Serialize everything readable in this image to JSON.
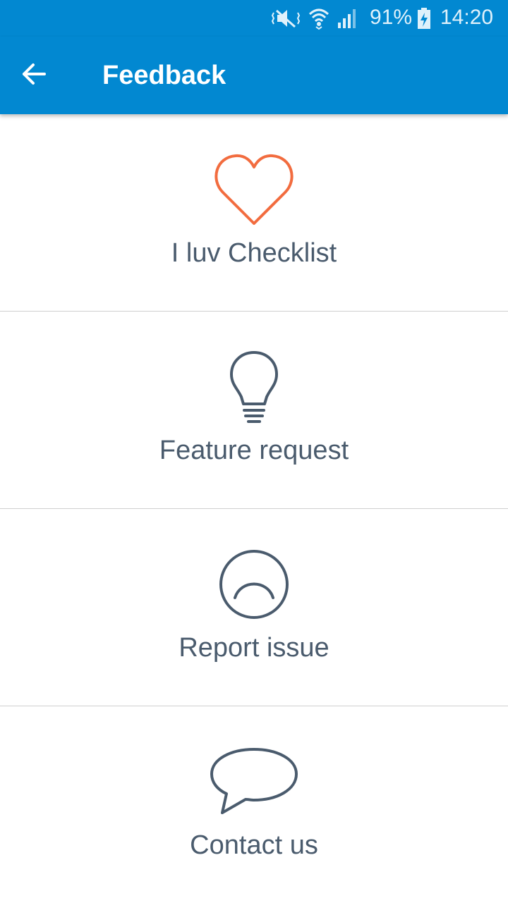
{
  "status_bar": {
    "battery": "91%",
    "time": "14:20",
    "icons": [
      "mute-icon",
      "wifi-icon",
      "signal-icon",
      "battery-charging-icon"
    ]
  },
  "app_bar": {
    "back_icon": "arrow-left-icon",
    "title": "Feedback"
  },
  "items": [
    {
      "label": "I luv Checklist",
      "icon": "heart-icon",
      "color": "#f26c3f"
    },
    {
      "label": "Feature request",
      "icon": "lightbulb-icon",
      "color": "#4a5b6d"
    },
    {
      "label": "Report issue",
      "icon": "sad-face-icon",
      "color": "#4a5b6d"
    },
    {
      "label": "Contact us",
      "icon": "speech-bubble-icon",
      "color": "#4a5b6d"
    }
  ],
  "colors": {
    "primary": "#0288d1",
    "text": "#4a5b6d",
    "accent": "#f26c3f",
    "divider": "#cfcfcf"
  }
}
